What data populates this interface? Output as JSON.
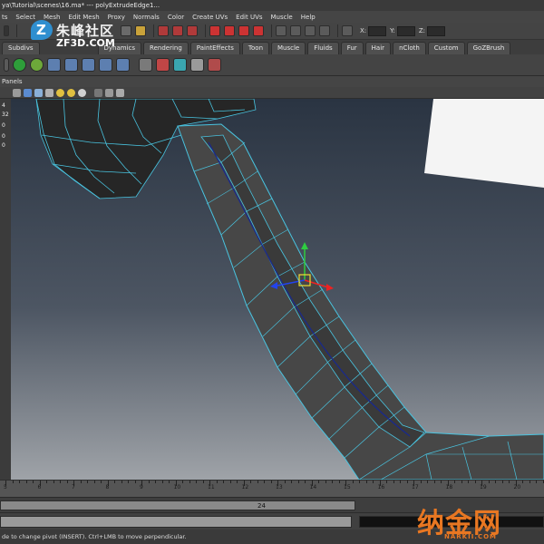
{
  "window": {
    "title": "ya\\Tutorial\\scenes\\16.ma*    ---    polyExtrudeEdge1..."
  },
  "menu": [
    "ts",
    "Select",
    "Mesh",
    "Edit Mesh",
    "Proxy",
    "Normals",
    "Color",
    "Create UVs",
    "Edit UVs",
    "Muscle",
    "Help"
  ],
  "toolbar": {
    "x_label": "X:",
    "y_label": "Y:",
    "z_label": "Z:"
  },
  "shelf_tabs": [
    "Subdivs",
    "Dynamics",
    "Rendering",
    "PaintEffects",
    "Toon",
    "Muscle",
    "Fluids",
    "Fur",
    "Hair",
    "nCloth",
    "Custom",
    "GoZBrush"
  ],
  "panel": {
    "menu_label": "Panels"
  },
  "channel_values": [
    "4",
    "32",
    "0",
    "0",
    "0"
  ],
  "timeline": {
    "ticks": [
      "5",
      "6",
      "7",
      "8",
      "9",
      "10",
      "11",
      "12",
      "13",
      "14",
      "15",
      "16",
      "17",
      "18",
      "19",
      "20"
    ]
  },
  "range": {
    "end": "24"
  },
  "help_line": "de to change pivot (INSERT). Ctrl+LMB to move perpendicular.",
  "watermarks": {
    "top_cn": "朱峰社区",
    "top_en": "ZF3D.COM",
    "bottom_cn": "纳金网",
    "bottom_en": "NARKII.COM"
  },
  "colors": {
    "mesh_face": "#474747",
    "mesh_wire": "#49c4e0",
    "viewport_top": "#2a3442",
    "viewport_bottom": "#9fa3a8",
    "accent_orange": "#e87722"
  }
}
